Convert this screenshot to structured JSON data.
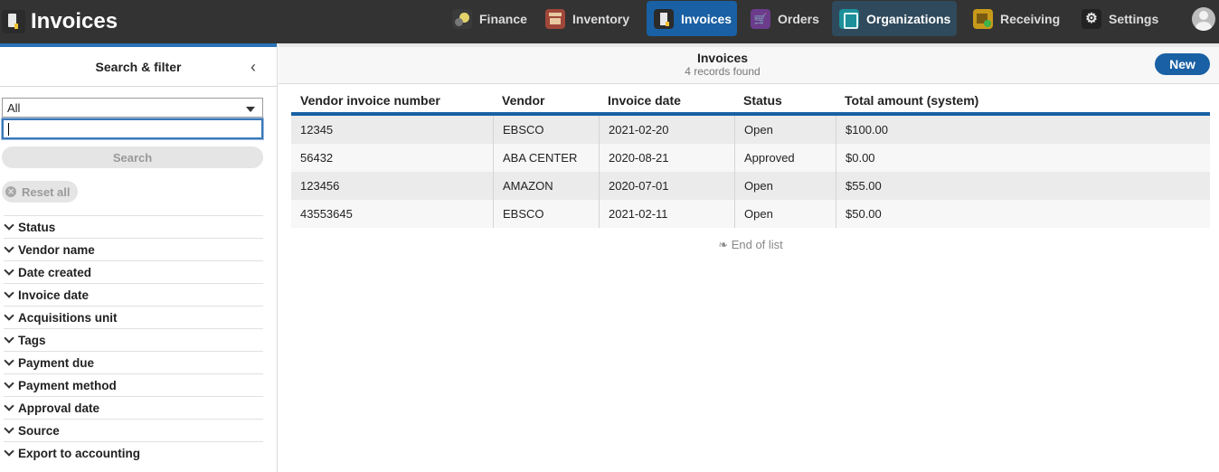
{
  "app": {
    "title": "Invoices"
  },
  "nav": [
    {
      "label": "Finance",
      "icon": "finance-icon"
    },
    {
      "label": "Inventory",
      "icon": "inventory-icon"
    },
    {
      "label": "Invoices",
      "icon": "invoices-icon",
      "active": true
    },
    {
      "label": "Orders",
      "icon": "orders-icon"
    },
    {
      "label": "Organizations",
      "icon": "organizations-icon",
      "hover": true
    },
    {
      "label": "Receiving",
      "icon": "receiving-icon"
    },
    {
      "label": "Settings",
      "icon": "gear-icon"
    }
  ],
  "filter": {
    "header": "Search & filter",
    "select_value": "All",
    "search_value": "",
    "search_label": "Search",
    "reset_label": "Reset all",
    "facets": [
      "Status",
      "Vendor name",
      "Date created",
      "Invoice date",
      "Acquisitions unit",
      "Tags",
      "Payment due",
      "Payment method",
      "Approval date",
      "Source",
      "Export to accounting"
    ]
  },
  "results": {
    "title": "Invoices",
    "subtitle": "4 records found",
    "new_label": "New",
    "columns": [
      "Vendor invoice number",
      "Vendor",
      "Invoice date",
      "Status",
      "Total amount (system)"
    ],
    "rows": [
      [
        "12345",
        "EBSCO",
        "2021-02-20",
        "Open",
        "$100.00"
      ],
      [
        "56432",
        "ABA CENTER",
        "2020-08-21",
        "Approved",
        "$0.00"
      ],
      [
        "123456",
        "AMAZON",
        "2020-07-01",
        "Open",
        "$55.00"
      ],
      [
        "43553645",
        "EBSCO",
        "2021-02-11",
        "Open",
        "$50.00"
      ]
    ],
    "end_of_list": "❧ End of list"
  },
  "colors": {
    "topbar": "#333333",
    "accent": "#1960a4",
    "hover": "#2f4a5c"
  }
}
